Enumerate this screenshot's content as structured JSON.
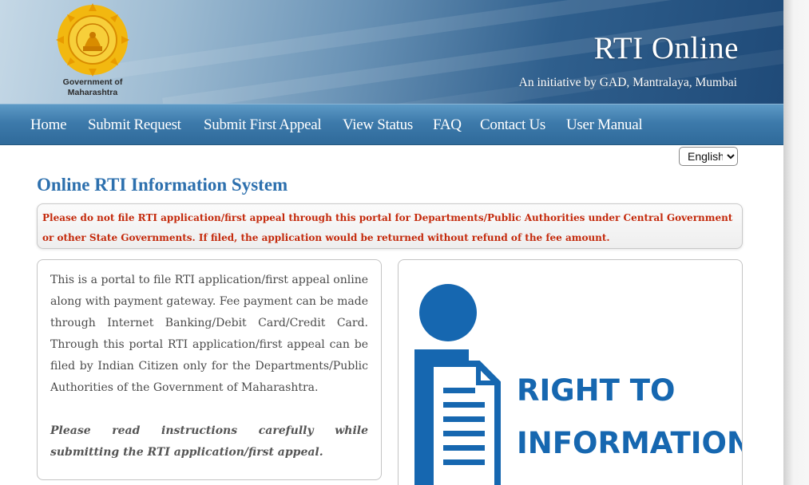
{
  "header": {
    "emblem_caption_line1": "Government of",
    "emblem_caption_line2": "Maharashtra",
    "title": "RTI Online",
    "subtitle": "An initiative by GAD, Mantralaya, Mumbai"
  },
  "nav": {
    "items": [
      {
        "label": "Home"
      },
      {
        "label": "Submit Request"
      },
      {
        "label": "Submit First Appeal"
      },
      {
        "label": "View Status"
      },
      {
        "label": "FAQ"
      },
      {
        "label": "Contact Us"
      },
      {
        "label": "User Manual"
      }
    ]
  },
  "language": {
    "selected": "English"
  },
  "main": {
    "heading": "Online RTI Information System",
    "notice": "Please do not file RTI application/first appeal through this portal for Departments/Public Authorities under Central Government or other State Governments. If filed, the application would be returned without refund of the fee amount.",
    "intro": "This is a portal to file RTI application/first appeal online along with payment gateway. Fee payment can be made through Internet Banking/Debit Card/Credit Card. Through this portal RTI application/first appeal can be filed by Indian Citizen only for the Departments/Public Authorities of the Government of Maharashtra.",
    "note_line1": "Please read instructions carefully while",
    "note_line2": "submitting the RTI application/first appeal.",
    "logo_text_line1": "RIGHT TO",
    "logo_text_line2": "INFORMATION"
  },
  "colors": {
    "accent_blue": "#2d70ae",
    "notice_red": "#c42a0c",
    "logo_blue": "#1667b0"
  }
}
